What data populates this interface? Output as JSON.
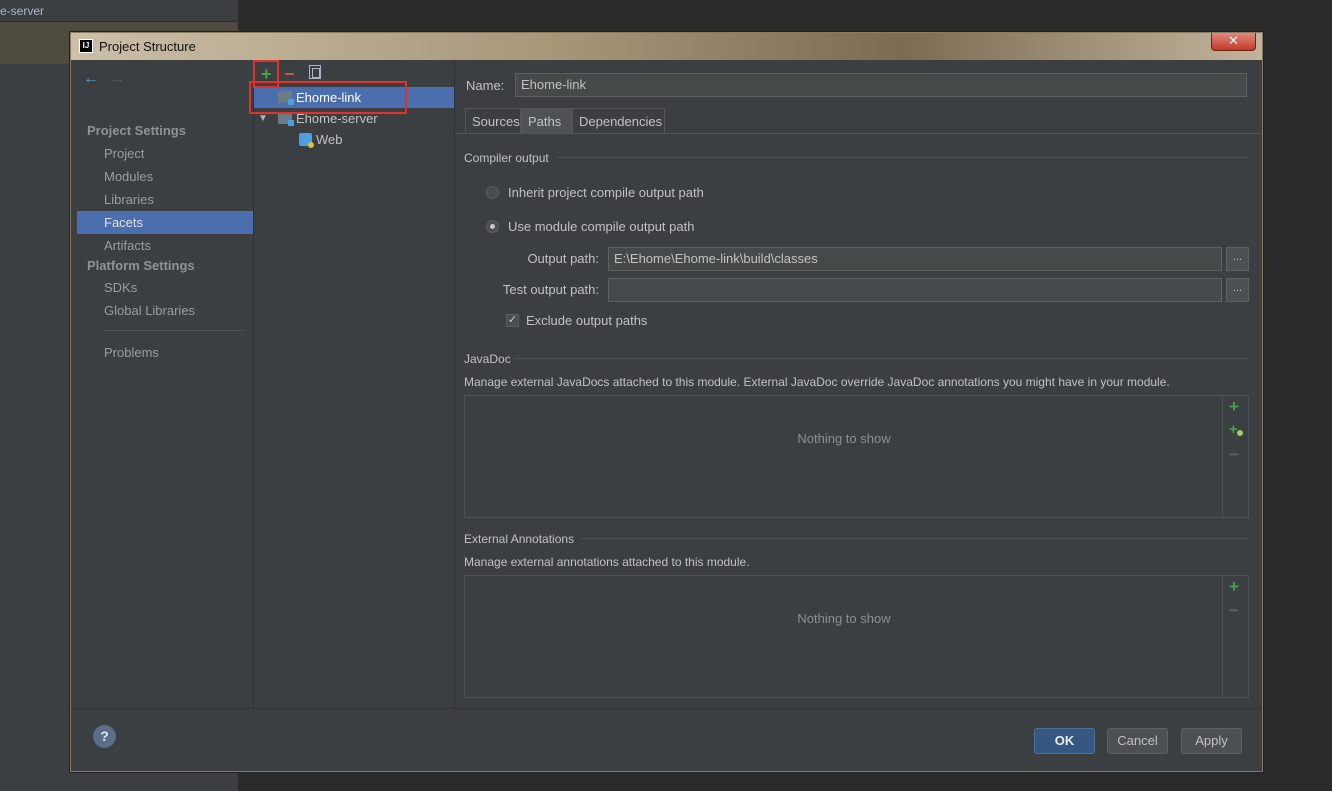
{
  "background": {
    "project_tab_fragment": "e-server"
  },
  "dialog": {
    "title": "Project Structure",
    "close_label": "✕"
  },
  "nav": {
    "back_icon": "←",
    "forward_icon": "→",
    "sections": [
      {
        "title": "Project Settings",
        "items": [
          "Project",
          "Modules",
          "Libraries",
          "Facets",
          "Artifacts"
        ]
      },
      {
        "title": "Platform Settings",
        "items": [
          "SDKs",
          "Global Libraries"
        ]
      }
    ],
    "problems_label": "Problems",
    "selected": "Facets"
  },
  "tree": {
    "toolbar": {
      "add": "+",
      "remove": "−"
    },
    "nodes": [
      {
        "label": "Ehome-link",
        "selected": true
      },
      {
        "label": "Ehome-server",
        "expander": "▼"
      },
      {
        "label": "Web"
      }
    ]
  },
  "main": {
    "name_label": "Name:",
    "name_value": "Ehome-link",
    "tabs": [
      "Sources",
      "Paths",
      "Dependencies"
    ],
    "active_tab": "Paths",
    "compiler_output": {
      "title": "Compiler output",
      "option_inherit": "Inherit project compile output path",
      "option_module": "Use module compile output path",
      "selected_option": "module",
      "output_path_label": "Output path:",
      "output_path_value": "E:\\Ehome\\Ehome-link\\build\\classes",
      "test_output_path_label": "Test output path:",
      "test_output_path_value": "",
      "browse_label": "...",
      "exclude_label": "Exclude output paths",
      "exclude_checked": true,
      "check_mark": "✓"
    },
    "javadoc": {
      "title": "JavaDoc",
      "description": "Manage external JavaDocs attached to this module. External JavaDoc override JavaDoc annotations you might have in your module.",
      "empty_text": "Nothing to show",
      "add": "+",
      "add_url": "+",
      "remove": "−"
    },
    "annotations": {
      "title": "External Annotations",
      "description": "Manage external annotations attached to this module.",
      "empty_text": "Nothing to show",
      "add": "+",
      "remove": "−"
    }
  },
  "footer": {
    "help": "?",
    "ok": "OK",
    "cancel": "Cancel",
    "apply": "Apply"
  },
  "colors": {
    "selection": "#4b6eaf",
    "highlight_box": "#e0312a",
    "add_green": "#48a24a",
    "remove_red": "#c75450",
    "primary_button": "#365880"
  }
}
